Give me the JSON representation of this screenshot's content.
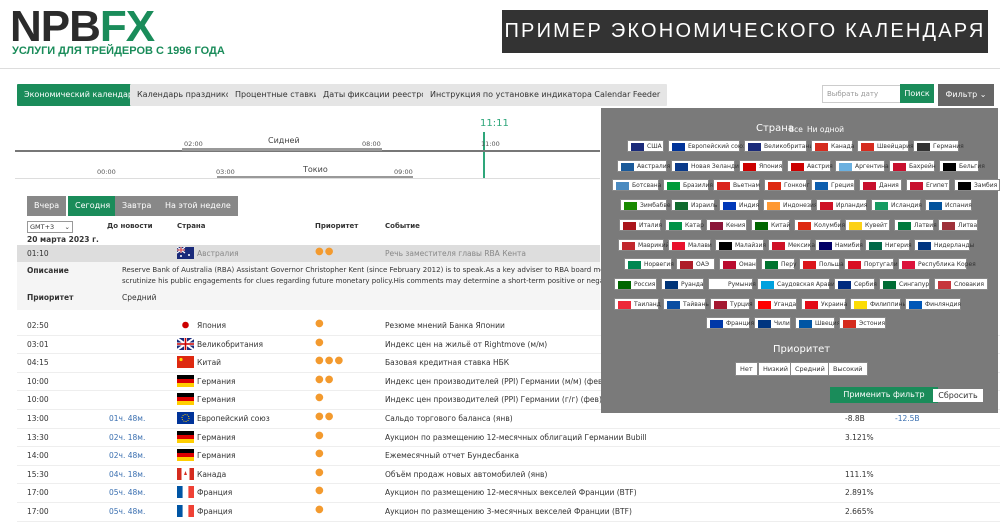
{
  "header": {
    "logo_main": "NPB",
    "logo_fx": "FX",
    "tagline": "УСЛУГИ ДЛЯ ТРЕЙДЕРОВ С 1996 ГОДА",
    "banner": "ПРИМЕР ЭКОНОМИЧЕСКОГО КАЛЕНДАРЯ"
  },
  "tabs": [
    "Экономический календарь",
    "Календарь праздников",
    "Процентные ставки",
    "Даты фиксации реестров",
    "Инструкция по установке индикатора Calendar Feeder"
  ],
  "search": {
    "placeholder": "Выбрать дату",
    "button": "Поиск"
  },
  "filter_label": "Фильтр",
  "timeline": {
    "now": "11:11",
    "sydney": "Сидней",
    "tokyo": "Токио",
    "t1": "02:00",
    "t2": "08:00",
    "t3": "11:00",
    "t4": "00:00",
    "t5": "03:00",
    "t6": "09:00"
  },
  "day_buttons": [
    "Вчера",
    "Сегодня",
    "Завтра",
    "На этой неделе"
  ],
  "table": {
    "tz": "GMT+3",
    "date": "20 марта 2023 г.",
    "col_to_news": "До новости",
    "col_country": "Страна",
    "col_priority": "Приоритет",
    "col_event": "Событие"
  },
  "selected": {
    "time": "01:10",
    "country": "Австралия",
    "prio": "●●",
    "event": "Речь заместителя главы RBA Кента",
    "desc_label": "Описание",
    "desc_text1": "Reserve Bank of Australia (RBA) Assistant Governor Christopher Kent (since February 2012) is to speak.As a key adviser to RBA board members,",
    "desc_text2": "scrutinize his public engagements for clues regarding future monetary policy.His comments may determine a short-term positive or negative tr",
    "prio_label": "Приоритет",
    "prio_value": "Средний"
  },
  "rows": [
    {
      "time": "02:50",
      "ago": "",
      "country": "Япония",
      "flag": "jp",
      "prio": "●",
      "event": "Резюме мнений Банка Японии",
      "v1": "",
      "v2": ""
    },
    {
      "time": "03:01",
      "ago": "",
      "country": "Великобритания",
      "flag": "gb",
      "prio": "●",
      "event": "Индекс цен на жильё от Rightmove (м/м)",
      "v1": "",
      "v2": ""
    },
    {
      "time": "04:15",
      "ago": "",
      "country": "Китай",
      "flag": "cn",
      "prio": "●●●",
      "event": "Базовая кредитная ставка НБК",
      "v1": "",
      "v2": ""
    },
    {
      "time": "10:00",
      "ago": "",
      "country": "Германия",
      "flag": "de",
      "prio": "●●",
      "event": "Индекс цен производителей (PPI) Германии (м/м) (фев)",
      "v1": "",
      "v2": ""
    },
    {
      "time": "10:00",
      "ago": "",
      "country": "Германия",
      "flag": "de",
      "prio": "●",
      "event": "Индекс цен производителей (PPI) Германии (г/г) (фев)",
      "v1": "",
      "v2": ""
    },
    {
      "time": "13:00",
      "ago": "01ч. 48м.",
      "country": "Европейский союз",
      "flag": "eu",
      "prio": "●●",
      "event": "Сальдо торгового баланса (янв)",
      "v1": "-8.8B",
      "v2": "-12.5B"
    },
    {
      "time": "13:30",
      "ago": "02ч. 18м.",
      "country": "Германия",
      "flag": "de",
      "prio": "●",
      "event": "Аукцион по размещению 12-месячных облигаций Германии Bubill",
      "v1": "3.121%",
      "v2": ""
    },
    {
      "time": "14:00",
      "ago": "02ч. 48м.",
      "country": "Германия",
      "flag": "de",
      "prio": "●",
      "event": "Ежемесячный отчет Бундесбанка",
      "v1": "",
      "v2": ""
    },
    {
      "time": "15:30",
      "ago": "04ч. 18м.",
      "country": "Канада",
      "flag": "ca",
      "prio": "●",
      "event": "Объём продаж новых автомобилей (янв)",
      "v1": "111.1%",
      "v2": ""
    },
    {
      "time": "17:00",
      "ago": "05ч. 48м.",
      "country": "Франция",
      "flag": "fr",
      "prio": "●",
      "event": "Аукцион по размещению 12-месячных векселей Франции (BTF)",
      "v1": "2.891%",
      "v2": ""
    },
    {
      "time": "17:00",
      "ago": "05ч. 48м.",
      "country": "Франция",
      "flag": "fr",
      "prio": "●",
      "event": "Аукцион по размещению 3-месячных векселей Франции (BTF)",
      "v1": "2.665%",
      "v2": ""
    }
  ],
  "filter": {
    "country_title": "Страна",
    "all": "Все",
    "none": "Ни одной",
    "priority_title": "Приоритет",
    "priorities": [
      "Нет",
      "Низкий",
      "Средний",
      "Высокий"
    ],
    "apply": "Применить фильтр",
    "reset": "Сбросить",
    "countries": [
      [
        "США",
        "Европейский союз",
        "Великобритания",
        "Канада",
        "Швейцария",
        "Германия"
      ],
      [
        "Австралия",
        "Новая Зеландия",
        "Япония",
        "Австрия",
        "Аргентина",
        "Бахрейн",
        "Бельгия"
      ],
      [
        "Ботсвана",
        "Бразилия",
        "Вьетнам",
        "Гонконг",
        "Греция",
        "Дания",
        "Египет",
        "Замбия"
      ],
      [
        "Зимбабве",
        "Израиль",
        "Индия",
        "Индонезия",
        "Ирландия",
        "Исландия",
        "Испания"
      ],
      [
        "Италия",
        "Катар",
        "Кения",
        "Китай",
        "Колумбия",
        "Кувейт",
        "Латвия",
        "Литва"
      ],
      [
        "Маврикий",
        "Малави",
        "Малайзия",
        "Мексика",
        "Намибия",
        "Нигерия",
        "Нидерланды"
      ],
      [
        "Норвегия",
        "ОАЭ",
        "Оман",
        "Перу",
        "Польша",
        "Португалия",
        "Республика Корея"
      ],
      [
        "Россия",
        "Руанда",
        "Румыния",
        "Саудовская Аравия",
        "Сербия",
        "Сингапур",
        "Словакия"
      ],
      [
        "Таиланд",
        "Тайвань",
        "Турция",
        "Уганда",
        "Украина",
        "Филиппины",
        "Финляндия"
      ],
      [
        "Франция",
        "Чили",
        "Швеция",
        "Эстония"
      ]
    ]
  },
  "colors": {
    "accent": "#1a8c5a",
    "priority": "#f39a2e",
    "link": "#3a6fb0",
    "panel": "#7a7a7a"
  }
}
